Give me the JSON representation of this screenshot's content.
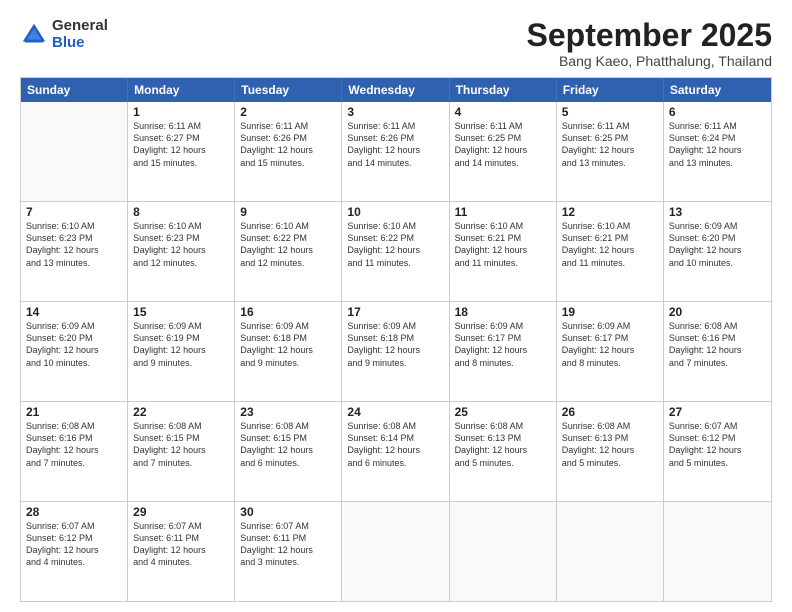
{
  "header": {
    "logo_general": "General",
    "logo_blue": "Blue",
    "month_title": "September 2025",
    "subtitle": "Bang Kaeo, Phatthalung, Thailand"
  },
  "days_of_week": [
    "Sunday",
    "Monday",
    "Tuesday",
    "Wednesday",
    "Thursday",
    "Friday",
    "Saturday"
  ],
  "rows": [
    [
      {
        "day": "",
        "lines": []
      },
      {
        "day": "1",
        "lines": [
          "Sunrise: 6:11 AM",
          "Sunset: 6:27 PM",
          "Daylight: 12 hours",
          "and 15 minutes."
        ]
      },
      {
        "day": "2",
        "lines": [
          "Sunrise: 6:11 AM",
          "Sunset: 6:26 PM",
          "Daylight: 12 hours",
          "and 15 minutes."
        ]
      },
      {
        "day": "3",
        "lines": [
          "Sunrise: 6:11 AM",
          "Sunset: 6:26 PM",
          "Daylight: 12 hours",
          "and 14 minutes."
        ]
      },
      {
        "day": "4",
        "lines": [
          "Sunrise: 6:11 AM",
          "Sunset: 6:25 PM",
          "Daylight: 12 hours",
          "and 14 minutes."
        ]
      },
      {
        "day": "5",
        "lines": [
          "Sunrise: 6:11 AM",
          "Sunset: 6:25 PM",
          "Daylight: 12 hours",
          "and 13 minutes."
        ]
      },
      {
        "day": "6",
        "lines": [
          "Sunrise: 6:11 AM",
          "Sunset: 6:24 PM",
          "Daylight: 12 hours",
          "and 13 minutes."
        ]
      }
    ],
    [
      {
        "day": "7",
        "lines": [
          "Sunrise: 6:10 AM",
          "Sunset: 6:23 PM",
          "Daylight: 12 hours",
          "and 13 minutes."
        ]
      },
      {
        "day": "8",
        "lines": [
          "Sunrise: 6:10 AM",
          "Sunset: 6:23 PM",
          "Daylight: 12 hours",
          "and 12 minutes."
        ]
      },
      {
        "day": "9",
        "lines": [
          "Sunrise: 6:10 AM",
          "Sunset: 6:22 PM",
          "Daylight: 12 hours",
          "and 12 minutes."
        ]
      },
      {
        "day": "10",
        "lines": [
          "Sunrise: 6:10 AM",
          "Sunset: 6:22 PM",
          "Daylight: 12 hours",
          "and 11 minutes."
        ]
      },
      {
        "day": "11",
        "lines": [
          "Sunrise: 6:10 AM",
          "Sunset: 6:21 PM",
          "Daylight: 12 hours",
          "and 11 minutes."
        ]
      },
      {
        "day": "12",
        "lines": [
          "Sunrise: 6:10 AM",
          "Sunset: 6:21 PM",
          "Daylight: 12 hours",
          "and 11 minutes."
        ]
      },
      {
        "day": "13",
        "lines": [
          "Sunrise: 6:09 AM",
          "Sunset: 6:20 PM",
          "Daylight: 12 hours",
          "and 10 minutes."
        ]
      }
    ],
    [
      {
        "day": "14",
        "lines": [
          "Sunrise: 6:09 AM",
          "Sunset: 6:20 PM",
          "Daylight: 12 hours",
          "and 10 minutes."
        ]
      },
      {
        "day": "15",
        "lines": [
          "Sunrise: 6:09 AM",
          "Sunset: 6:19 PM",
          "Daylight: 12 hours",
          "and 9 minutes."
        ]
      },
      {
        "day": "16",
        "lines": [
          "Sunrise: 6:09 AM",
          "Sunset: 6:18 PM",
          "Daylight: 12 hours",
          "and 9 minutes."
        ]
      },
      {
        "day": "17",
        "lines": [
          "Sunrise: 6:09 AM",
          "Sunset: 6:18 PM",
          "Daylight: 12 hours",
          "and 9 minutes."
        ]
      },
      {
        "day": "18",
        "lines": [
          "Sunrise: 6:09 AM",
          "Sunset: 6:17 PM",
          "Daylight: 12 hours",
          "and 8 minutes."
        ]
      },
      {
        "day": "19",
        "lines": [
          "Sunrise: 6:09 AM",
          "Sunset: 6:17 PM",
          "Daylight: 12 hours",
          "and 8 minutes."
        ]
      },
      {
        "day": "20",
        "lines": [
          "Sunrise: 6:08 AM",
          "Sunset: 6:16 PM",
          "Daylight: 12 hours",
          "and 7 minutes."
        ]
      }
    ],
    [
      {
        "day": "21",
        "lines": [
          "Sunrise: 6:08 AM",
          "Sunset: 6:16 PM",
          "Daylight: 12 hours",
          "and 7 minutes."
        ]
      },
      {
        "day": "22",
        "lines": [
          "Sunrise: 6:08 AM",
          "Sunset: 6:15 PM",
          "Daylight: 12 hours",
          "and 7 minutes."
        ]
      },
      {
        "day": "23",
        "lines": [
          "Sunrise: 6:08 AM",
          "Sunset: 6:15 PM",
          "Daylight: 12 hours",
          "and 6 minutes."
        ]
      },
      {
        "day": "24",
        "lines": [
          "Sunrise: 6:08 AM",
          "Sunset: 6:14 PM",
          "Daylight: 12 hours",
          "and 6 minutes."
        ]
      },
      {
        "day": "25",
        "lines": [
          "Sunrise: 6:08 AM",
          "Sunset: 6:13 PM",
          "Daylight: 12 hours",
          "and 5 minutes."
        ]
      },
      {
        "day": "26",
        "lines": [
          "Sunrise: 6:08 AM",
          "Sunset: 6:13 PM",
          "Daylight: 12 hours",
          "and 5 minutes."
        ]
      },
      {
        "day": "27",
        "lines": [
          "Sunrise: 6:07 AM",
          "Sunset: 6:12 PM",
          "Daylight: 12 hours",
          "and 5 minutes."
        ]
      }
    ],
    [
      {
        "day": "28",
        "lines": [
          "Sunrise: 6:07 AM",
          "Sunset: 6:12 PM",
          "Daylight: 12 hours",
          "and 4 minutes."
        ]
      },
      {
        "day": "29",
        "lines": [
          "Sunrise: 6:07 AM",
          "Sunset: 6:11 PM",
          "Daylight: 12 hours",
          "and 4 minutes."
        ]
      },
      {
        "day": "30",
        "lines": [
          "Sunrise: 6:07 AM",
          "Sunset: 6:11 PM",
          "Daylight: 12 hours",
          "and 3 minutes."
        ]
      },
      {
        "day": "",
        "lines": []
      },
      {
        "day": "",
        "lines": []
      },
      {
        "day": "",
        "lines": []
      },
      {
        "day": "",
        "lines": []
      }
    ]
  ]
}
